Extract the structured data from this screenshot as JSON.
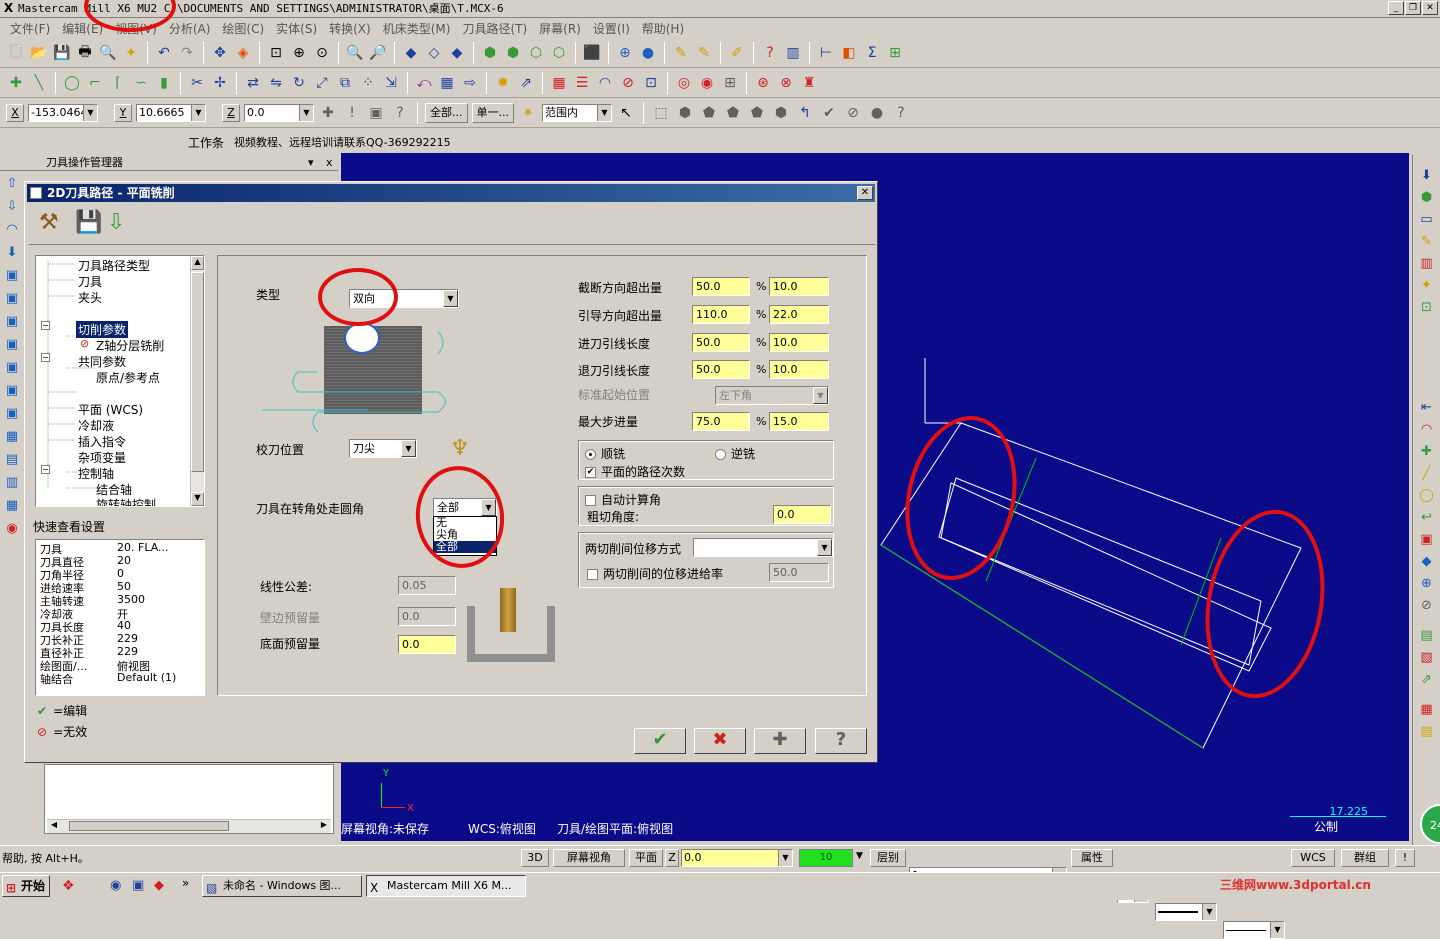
{
  "window": {
    "title": "Mastercam Mill X6 MU2 C:\\DOCUMENTS AND SETTINGS\\ADMINISTRATOR\\桌面\\T.MCX-6",
    "logo": "X"
  },
  "menu": [
    "文件(F)",
    "编辑(E)",
    "视图(V)",
    "分析(A)",
    "绘图(C)",
    "实体(S)",
    "转换(X)",
    "机床类型(M)",
    "刀具路径(T)",
    "屏幕(R)",
    "设置(I)",
    "帮助(H)"
  ],
  "coords": {
    "x_label": "X",
    "x_value": "-153.0464",
    "y_label": "Y",
    "y_value": "10.6665",
    "z_label": "Z",
    "z_value": "0.0",
    "all_btn": "全部...",
    "single_btn": "单一...",
    "range": "范围内"
  },
  "info_line": {
    "workset_label": "工作条",
    "text": "视频教程、远程培训请联系QQ-369292215"
  },
  "manager": {
    "title": "刀具操作管理器",
    "pin": "▾",
    "close": "x"
  },
  "dialog": {
    "title": "2D刀具路径 - 平面铣削",
    "close": "✕",
    "tree": [
      "刀具路径类型",
      "刀具",
      "夹头",
      "切削参数",
      "Z轴分层铣削",
      "共同参数",
      "原点/参考点",
      "平面 (WCS)",
      "冷却液",
      "插入指令",
      "杂项变量",
      "控制轴",
      "结合轴",
      "旋转轴控制"
    ],
    "quick_view_title": "快速查看设置",
    "quick_view": [
      [
        "刀具",
        "20. FLA..."
      ],
      [
        "刀具直径",
        "20"
      ],
      [
        "刀角半径",
        "0"
      ],
      [
        "进给速率",
        "50"
      ],
      [
        "主轴转速",
        "3500"
      ],
      [
        "冷却液",
        "开"
      ],
      [
        "刀具长度",
        "40"
      ],
      [
        "刀长补正",
        "229"
      ],
      [
        "直径补正",
        "229"
      ],
      [
        "绘图面/...",
        "俯视图"
      ],
      [
        "轴结合",
        "Default (1)"
      ]
    ],
    "legend": [
      {
        "icon": "✔",
        "color": "#2a9a2a",
        "label": "=编辑"
      },
      {
        "icon": "⊘",
        "color": "#d02020",
        "label": "=无效"
      }
    ],
    "type_label": "类型",
    "type_value": "双向",
    "tool_pos_label": "校刀位置",
    "tool_pos_value": "刀尖",
    "corner_label": "刀具在转角处走圆角",
    "corner_value": "全部",
    "corner_options": [
      "无",
      "尖角",
      "全部"
    ],
    "tolerance_label": "线性公差:",
    "tolerance_value": "0.05",
    "wall_stock_label": "壁边预留量",
    "wall_stock_value": "0.0",
    "floor_stock_label": "底面预留量",
    "floor_stock_value": "0.0",
    "params": [
      {
        "label": "截断方向超出量",
        "v1": "50.0",
        "v2": "10.0"
      },
      {
        "label": "引导方向超出量",
        "v1": "110.0",
        "v2": "22.0"
      },
      {
        "label": "进刀引线长度",
        "v1": "50.0",
        "v2": "10.0"
      },
      {
        "label": "退刀引线长度",
        "v1": "50.0",
        "v2": "10.0"
      }
    ],
    "percent": "%",
    "std_start_label": "标准起始位置",
    "std_start_value": "左下角",
    "max_step_label": "最大步进量",
    "max_step_v1": "75.0",
    "max_step_v2": "15.0",
    "climb": "顺铣",
    "conventional": "逆铣",
    "path_order": "平面的路径次数",
    "auto_angle": "自动计算角",
    "rough_angle_label": "粗切角度:",
    "rough_angle_value": "0.0",
    "move_between_label": "两切削间位移方式",
    "move_between_value": "",
    "move_feed_label": "两切削间的位移进给率",
    "move_feed_value": "50.0",
    "buttons": {
      "ok": "✔",
      "cancel": "✖",
      "add": "✚",
      "help": "?"
    }
  },
  "viewport": {
    "status1": "屏幕视角:未保存",
    "status2": "WCS:俯视图",
    "status3": "刀具/绘图平面:俯视图",
    "scale_value": "17.225",
    "scale_unit": "公制",
    "axis_y": "Y",
    "axis_x": "X"
  },
  "statusbar": {
    "help": "帮助, 按 Alt+H。",
    "mode_3d": "3D",
    "screen_view": "屏幕视角",
    "plane": "平面",
    "z_label": "Z",
    "z_value": "0.0",
    "level_num": "10",
    "level_label": "层别",
    "level_value": "1",
    "attr": "属性",
    "wcs": "WCS",
    "group": "群组",
    "bang": "!"
  },
  "taskbar": {
    "start": "开始",
    "task1": "未命名 - Windows 图...",
    "task2": "Mastercam Mill X6 M...",
    "chevron": "»",
    "watermark": "三维网www.3dportal.cn",
    "clock": "24"
  }
}
